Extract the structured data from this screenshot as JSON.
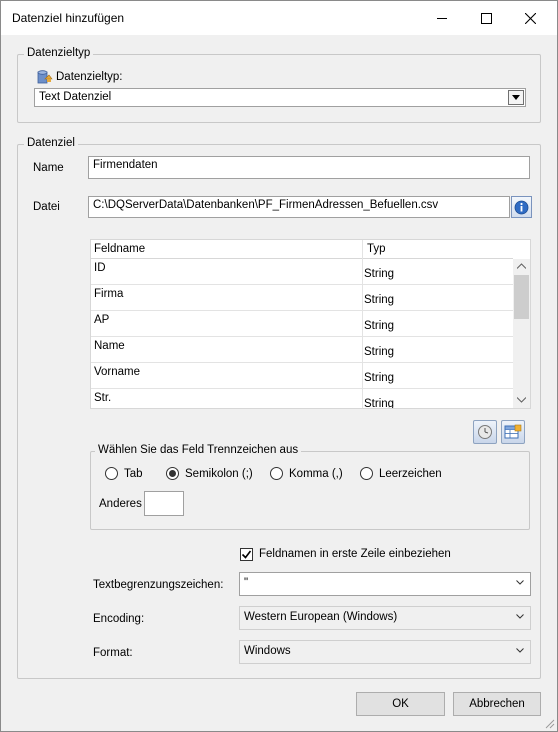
{
  "window": {
    "title": "Datenziel hinzufügen"
  },
  "zieltyp_group": {
    "legend": "Datenzieltyp",
    "label": "Datenzieltyp:",
    "selected": "Text Datenziel"
  },
  "ziel_group": {
    "legend": "Datenziel",
    "name_label": "Name",
    "name_value": "Firmendaten",
    "datei_label": "Datei",
    "datei_value": "C:\\DQServerData\\Datenbanken\\PF_FirmenAdressen_Befuellen.csv"
  },
  "fields_grid": {
    "columns": [
      "Feldname",
      "Typ"
    ],
    "rows": [
      {
        "feldname": "ID",
        "typ": "String"
      },
      {
        "feldname": "Firma",
        "typ": "String"
      },
      {
        "feldname": "AP",
        "typ": "String"
      },
      {
        "feldname": "Name",
        "typ": "String"
      },
      {
        "feldname": "Vorname",
        "typ": "String"
      },
      {
        "feldname": "Str.",
        "typ": "String"
      }
    ]
  },
  "separator_group": {
    "legend": "Wählen Sie das Feld Trennzeichen aus",
    "options": [
      "Tab",
      "Semikolon (;)",
      "Komma (,)",
      "Leerzeichen"
    ],
    "selected": "Semikolon (;)",
    "other_label": "Anderes",
    "other_value": ""
  },
  "options": {
    "header_checkbox_label": "Feldnamen in erste Zeile einbeziehen",
    "header_checked": true,
    "textquote_label": "Textbegrenzungszeichen:",
    "textquote_value": "\"",
    "encoding_label": "Encoding:",
    "encoding_value": "Western European (Windows)",
    "format_label": "Format:",
    "format_value": "Windows"
  },
  "buttons": {
    "ok": "OK",
    "cancel": "Abbrechen"
  }
}
